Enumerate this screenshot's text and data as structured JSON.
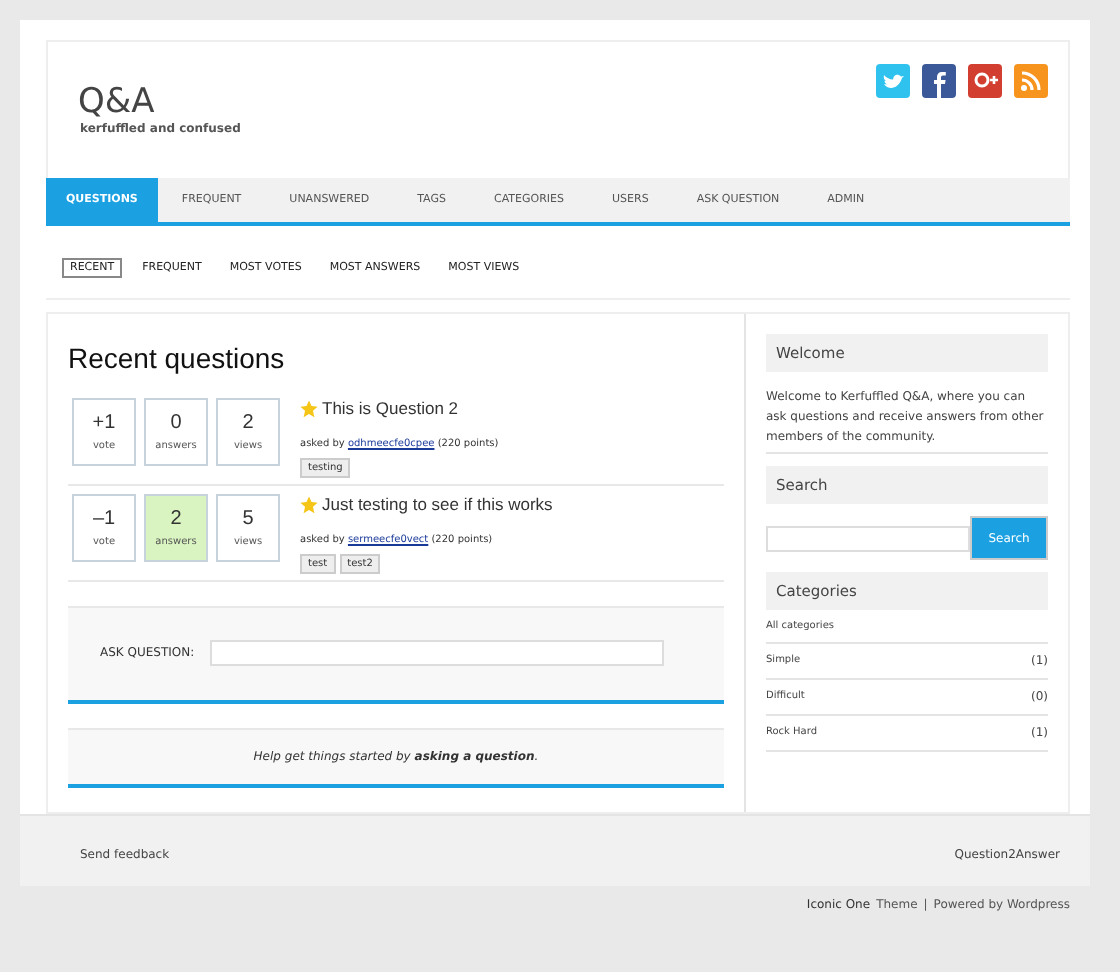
{
  "site": {
    "title": "Q&A",
    "tagline": "kerfuffled and confused"
  },
  "social": [
    {
      "kind": "twitter"
    },
    {
      "kind": "facebook"
    },
    {
      "kind": "googleplus"
    },
    {
      "kind": "rss"
    }
  ],
  "nav": [
    {
      "label": "QUESTIONS",
      "selected": true
    },
    {
      "label": "FREQUENT",
      "selected": false
    },
    {
      "label": "UNANSWERED",
      "selected": false
    },
    {
      "label": "TAGS",
      "selected": false
    },
    {
      "label": "CATEGORIES",
      "selected": false
    },
    {
      "label": "USERS",
      "selected": false
    },
    {
      "label": "ASK QUESTION",
      "selected": false
    },
    {
      "label": "ADMIN",
      "selected": false
    }
  ],
  "subnav": [
    {
      "label": "RECENT",
      "selected": true
    },
    {
      "label": "FREQUENT",
      "selected": false
    },
    {
      "label": "MOST VOTES",
      "selected": false
    },
    {
      "label": "MOST ANSWERS",
      "selected": false
    },
    {
      "label": "MOST VIEWS",
      "selected": false
    }
  ],
  "heading": "Recent questions",
  "questions": [
    {
      "votes": "+1",
      "votes_label": "vote",
      "answers": "0",
      "answers_label": "answers",
      "answered": false,
      "views": "2",
      "views_label": "views",
      "title": "This is Question 2",
      "asked_by": "asked by",
      "user": "odhmeecfe0cpee",
      "points": "(220 points)",
      "tags": [
        "testing"
      ]
    },
    {
      "votes": "–1",
      "votes_label": "vote",
      "answers": "2",
      "answers_label": "answers",
      "answered": true,
      "views": "5",
      "views_label": "views",
      "title": "Just testing to see if this works",
      "asked_by": "asked by",
      "user": "sermeecfe0vect",
      "points": "(220 points)",
      "tags": [
        "test",
        "test2"
      ]
    }
  ],
  "ask": {
    "label": "ASK QUESTION:"
  },
  "help": "Help get things started by **asking a question**.",
  "sidebar": {
    "welcome_title": "Welcome",
    "welcome_text": "Welcome to Kerfuffled Q&A, where you can ask questions and receive answers from other members of the community.",
    "search_title": "Search",
    "search_button": "Search",
    "categories_title": "Categories",
    "categories": [
      {
        "name": "All categories"
      },
      {
        "name": "Simple",
        "count": "(1)"
      },
      {
        "name": "Difficult",
        "count": "(0)"
      },
      {
        "name": "Rock Hard",
        "count": "(1)"
      }
    ]
  },
  "footer": {
    "feedback": "Send feedback",
    "powered": "Question2Answer"
  },
  "credit": {
    "theme": "Iconic One",
    "theme_word": "Theme",
    "sep": "|",
    "powered": "Powered by Wordpress"
  }
}
